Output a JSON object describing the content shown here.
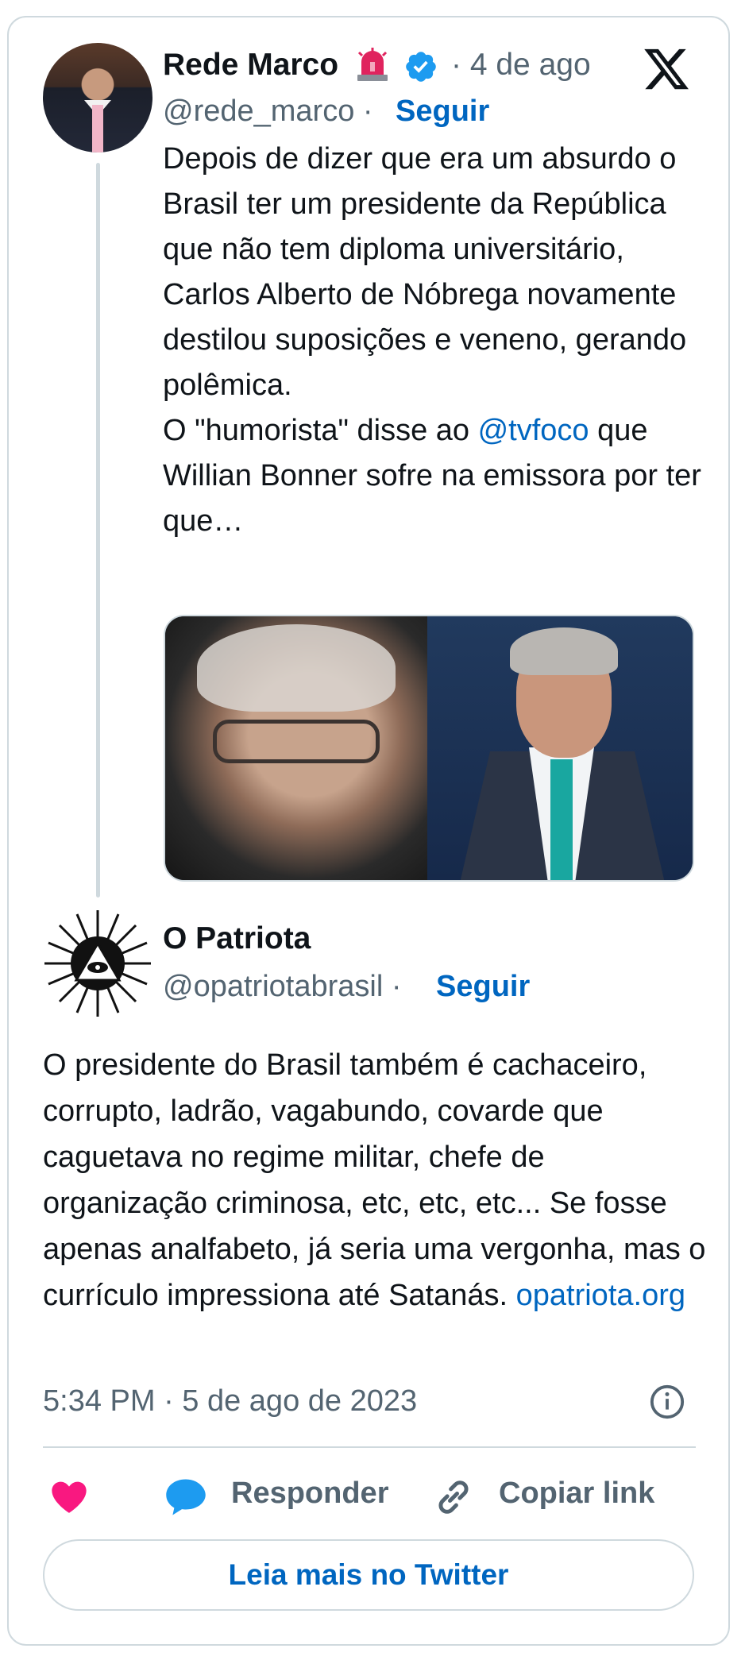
{
  "brand_colors": {
    "link": "#0066c0",
    "muted": "#536471",
    "text": "#0f1419",
    "border": "#cfd9de",
    "like": "#f91880",
    "reply": "#1d9bf0"
  },
  "quoted_tweet": {
    "display_name": "Rede Marco",
    "emoji_icon": "siren-emoji-icon",
    "verified_icon": "verified-badge-icon",
    "time": "· 4 de ago",
    "handle": "@rede_marco ·",
    "follow_label": "Seguir",
    "body_para1": "Depois de dizer que era um absurdo o Brasil ter um presidente da República que não tem diploma universitário, Carlos Alberto de Nóbrega novamente destilou suposições e veneno, gerando polêmica.",
    "body_para2_pre": "O \"humorista\" disse ao ",
    "body_para2_mention": "@tvfoco",
    "body_para2_post": " que Willian Bonner sofre na emissora por ter que…"
  },
  "tweet": {
    "display_name": "O Patriota",
    "handle": "@opatriotabrasil ·",
    "follow_label": "Seguir",
    "body_text": "O presidente do Brasil também é cachaceiro, corrupto, ladrão, vagabundo, covarde que caguetava no regime militar, chefe de organização criminosa, etc, etc, etc... Se fosse apenas analfabeto, já seria uma vergonha, mas o currículo impressiona até Satanás. ",
    "body_link": "opatriota.org",
    "timestamp": "5:34 PM · 5 de ago de 2023"
  },
  "actions": {
    "like_icon": "heart-icon",
    "reply_icon": "speech-bubble-icon",
    "reply_label": "Responder",
    "copy_icon": "link-icon",
    "copy_label": "Copiar link"
  },
  "footer": {
    "read_more_label": "Leia mais no Twitter"
  }
}
